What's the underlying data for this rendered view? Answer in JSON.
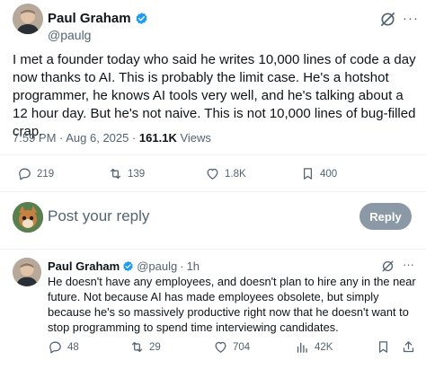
{
  "tweet": {
    "author_name": "Paul Graham",
    "handle": "@paulg",
    "text": "I met a founder today who said he writes 10,000 lines of code a day now thanks to AI. This is probably the limit case. He's a hotshot programmer, he knows AI tools very well, and he's talking about a 12 hour day. But he's not naive. This is not 10,000 lines of bug-filled crap.",
    "timestamp": "7:59 PM · Aug 6, 2025 · ",
    "views_count": "161.1K",
    "views_label": " Views",
    "more_glyph": "···",
    "actions": {
      "replies": "219",
      "retweets": "139",
      "likes": "1.8K",
      "bookmarks": "400"
    }
  },
  "composer": {
    "placeholder": "Post your reply",
    "reply_button": "Reply"
  },
  "reply": {
    "author_name": "Paul Graham",
    "handle": "@paulg",
    "dot": "·",
    "time": "1h",
    "more_glyph": "···",
    "text": "He doesn't have any employees, and doesn't plan to hire any in the near future. Not because AI has made employees obsolete, but simply because he's so massively productive right now that he doesn't want to stop programming to spend time interviewing candidates.",
    "actions": {
      "replies": "48",
      "retweets": "29",
      "likes": "704",
      "views": "42K"
    }
  },
  "colors": {
    "text": "#0f1419",
    "muted": "#536471",
    "verified": "#1d9bf0",
    "reply_button": "#8b98a5",
    "divider": "#eff3f4"
  }
}
